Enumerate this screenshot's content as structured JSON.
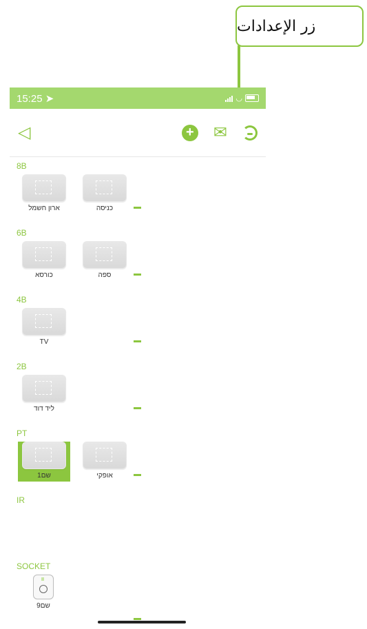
{
  "callout": {
    "text": "زر الإعدادات"
  },
  "status": {
    "time": "15:25",
    "location_arrow": "➤",
    "signal_bars": 3,
    "wifi": "◡"
  },
  "toolbar": {
    "back_icon": "◁",
    "add_icon": "+",
    "mail_icon": "✉",
    "settings_icon": "settings"
  },
  "sections": [
    {
      "label": "8B",
      "devices": [
        "ארון חשמל",
        "כניסה"
      ]
    },
    {
      "label": "6B",
      "devices": [
        "כורסא",
        "ספה"
      ]
    },
    {
      "label": "4B",
      "devices": [
        "TV"
      ]
    },
    {
      "label": "2B",
      "devices": [
        "ליד דוד"
      ]
    },
    {
      "label": "PT",
      "devices": [
        "שם1",
        "אופקי"
      ],
      "selected": "שם1"
    },
    {
      "label": "IR",
      "devices": []
    },
    {
      "label": "SOCKET",
      "devices": [
        "שם9"
      ]
    }
  ],
  "colors": {
    "accent": "#8cc63f",
    "statusbar": "#a4d86e"
  }
}
